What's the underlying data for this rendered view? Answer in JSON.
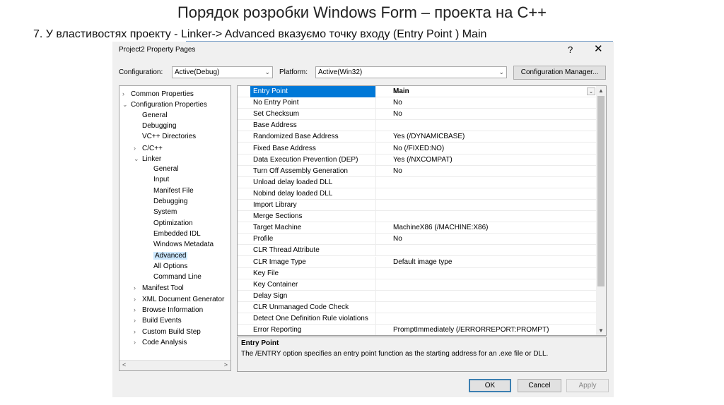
{
  "slide": {
    "title": "Порядок розробки  Windows Form – проекта на С++",
    "subtitle": "7. У властивостях проекту  - Linker-> Advanced вказуємо точку входу (Entry Point ) Main"
  },
  "dialog": {
    "title": "Project2 Property Pages",
    "help": "?",
    "close": "✕",
    "configuration_label": "Configuration:",
    "configuration_value": "Active(Debug)",
    "platform_label": "Platform:",
    "platform_value": "Active(Win32)",
    "config_manager_label": "Configuration Manager...",
    "ok_label": "OK",
    "cancel_label": "Cancel",
    "apply_label": "Apply"
  },
  "tree": {
    "items": [
      {
        "label": "Common Properties",
        "exp": "›"
      },
      {
        "label": "Configuration Properties",
        "exp": "⌄"
      },
      {
        "label": "General",
        "exp": ""
      },
      {
        "label": "Debugging",
        "exp": ""
      },
      {
        "label": "VC++ Directories",
        "exp": ""
      },
      {
        "label": "C/C++",
        "exp": "›"
      },
      {
        "label": "Linker",
        "exp": "⌄"
      },
      {
        "label": "General",
        "exp": ""
      },
      {
        "label": "Input",
        "exp": ""
      },
      {
        "label": "Manifest File",
        "exp": ""
      },
      {
        "label": "Debugging",
        "exp": ""
      },
      {
        "label": "System",
        "exp": ""
      },
      {
        "label": "Optimization",
        "exp": ""
      },
      {
        "label": "Embedded IDL",
        "exp": ""
      },
      {
        "label": "Windows Metadata",
        "exp": ""
      },
      {
        "label": "Advanced",
        "exp": ""
      },
      {
        "label": "All Options",
        "exp": ""
      },
      {
        "label": "Command Line",
        "exp": ""
      },
      {
        "label": "Manifest Tool",
        "exp": "›"
      },
      {
        "label": "XML Document Generator",
        "exp": "›"
      },
      {
        "label": "Browse Information",
        "exp": "›"
      },
      {
        "label": "Build Events",
        "exp": "›"
      },
      {
        "label": "Custom Build Step",
        "exp": "›"
      },
      {
        "label": "Code Analysis",
        "exp": "›"
      }
    ],
    "scroll_left": "<",
    "scroll_right": ">"
  },
  "grid": {
    "rows": [
      {
        "name": "Entry Point",
        "value": "Main"
      },
      {
        "name": "No Entry Point",
        "value": "No"
      },
      {
        "name": "Set Checksum",
        "value": "No"
      },
      {
        "name": "Base Address",
        "value": ""
      },
      {
        "name": "Randomized Base Address",
        "value": "Yes (/DYNAMICBASE)"
      },
      {
        "name": "Fixed Base Address",
        "value": "No (/FIXED:NO)"
      },
      {
        "name": "Data Execution Prevention (DEP)",
        "value": "Yes (/NXCOMPAT)"
      },
      {
        "name": "Turn Off Assembly Generation",
        "value": "No"
      },
      {
        "name": "Unload delay loaded DLL",
        "value": ""
      },
      {
        "name": "Nobind delay loaded DLL",
        "value": ""
      },
      {
        "name": "Import Library",
        "value": ""
      },
      {
        "name": "Merge Sections",
        "value": ""
      },
      {
        "name": "Target Machine",
        "value": "MachineX86 (/MACHINE:X86)"
      },
      {
        "name": "Profile",
        "value": "No"
      },
      {
        "name": "CLR Thread Attribute",
        "value": ""
      },
      {
        "name": "CLR Image Type",
        "value": "Default image type"
      },
      {
        "name": "Key File",
        "value": ""
      },
      {
        "name": "Key Container",
        "value": ""
      },
      {
        "name": "Delay Sign",
        "value": ""
      },
      {
        "name": "CLR Unmanaged Code Check",
        "value": ""
      },
      {
        "name": "Detect One Definition Rule violations",
        "value": ""
      },
      {
        "name": "Error Reporting",
        "value": "PromptImmediately (/ERRORREPORT:PROMPT)"
      }
    ],
    "dropdown_glyph": "⌄",
    "scroll_up": "▲",
    "scroll_down": "▼"
  },
  "description": {
    "title": "Entry Point",
    "text": "The /ENTRY option specifies an entry point function as the starting address for an .exe file or DLL."
  },
  "colors": {
    "selection": "#0078d7",
    "tree_selection": "#cce8ff",
    "primary_button_border": "#3c7fb1"
  }
}
